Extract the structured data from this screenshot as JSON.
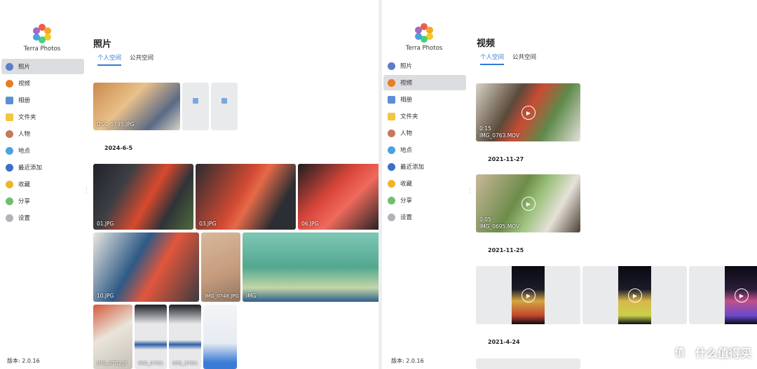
{
  "app": {
    "name": "Terra Photos",
    "version": "版本: 2.0.16"
  },
  "sidebar": {
    "items": [
      {
        "label": "照片",
        "icon": "photo-icon"
      },
      {
        "label": "视频",
        "icon": "video-icon"
      },
      {
        "label": "相册",
        "icon": "album-icon"
      },
      {
        "label": "文件夹",
        "icon": "folder-icon"
      },
      {
        "label": "人物",
        "icon": "person-icon"
      },
      {
        "label": "地点",
        "icon": "location-icon"
      },
      {
        "label": "最近添加",
        "icon": "recent-icon"
      },
      {
        "label": "收藏",
        "icon": "star-icon"
      },
      {
        "label": "分享",
        "icon": "share-icon"
      },
      {
        "label": "设置",
        "icon": "gear-icon"
      }
    ]
  },
  "left": {
    "title": "照片",
    "active_nav": 0,
    "tabs": [
      "个人空间",
      "公共空间"
    ],
    "top_caption": "DSC_5795.JPG",
    "date1": "2024-6-5",
    "photos": [
      "01.JPG",
      "03.JPG",
      "06.JPG",
      "10.JPG",
      "IMG_0748.JPG",
      "IMG",
      "IMG_0762.JP",
      "IMG_0763.",
      "IMG_0764."
    ]
  },
  "right": {
    "title": "视频",
    "active_nav": 1,
    "tabs": [
      "个人空间",
      "公共空间"
    ],
    "videos": [
      {
        "duration": "0:15",
        "name": "IMG_0763.MOV"
      },
      {
        "duration": "0:05",
        "name": "IMG_0695.MOV"
      }
    ],
    "dates": [
      "2021-11-27",
      "2021-11-25",
      "2021-4-24"
    ]
  },
  "watermark": {
    "text": "什么值得买"
  },
  "colors": {
    "accent": "#2f7bd8",
    "active_bg": "#dcdde1"
  }
}
